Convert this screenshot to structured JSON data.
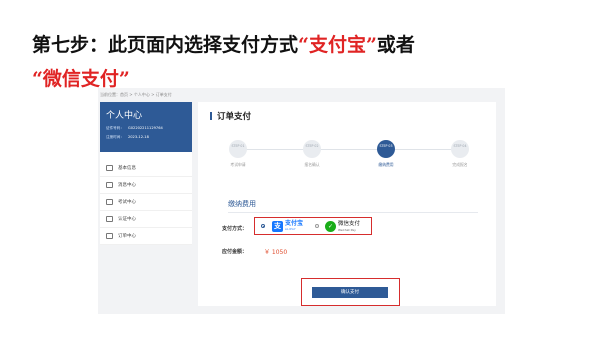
{
  "headline": {
    "part1": "第七步：此页面内选择支付方式",
    "alipay_quoted": "“支付宝”",
    "part2": "或者",
    "wechat_quoted": "“微信支付”"
  },
  "breadcrumb": "当前位置：首页 > 个人中心 > 订单支付",
  "sidebar": {
    "title": "个人中心",
    "id_label": "证件号码：",
    "id_value": "G02202211129764",
    "date_label": "注册时间：",
    "date_value": "2023-12-18",
    "items": [
      {
        "label": "基本信息",
        "icon": "user-icon"
      },
      {
        "label": "消息中心",
        "icon": "message-icon"
      },
      {
        "label": "考试中心",
        "icon": "exam-icon"
      },
      {
        "label": "认证中心",
        "icon": "cert-icon"
      },
      {
        "label": "订单中心",
        "icon": "order-icon"
      }
    ]
  },
  "main": {
    "title": "订单支付",
    "steps": [
      {
        "code": "STEP 01",
        "label": "考试申请",
        "active": false
      },
      {
        "code": "STEP 02",
        "label": "报名确认",
        "active": false
      },
      {
        "code": "STEP 03",
        "label": "缴纳费用",
        "active": true
      },
      {
        "code": "STEP 04",
        "label": "完成报名",
        "active": false
      }
    ],
    "section_title": "缴纳费用",
    "pay_method_label": "支付方式：",
    "alipay": {
      "cn": "支付宝",
      "en": "ALIPAY"
    },
    "wechat": {
      "cn": "微信支付",
      "en": "WeChat Pay"
    },
    "amount_label": "应付金额：",
    "amount_value": "￥ 1050",
    "submit_label": "确认支付"
  },
  "colors": {
    "brand": "#2e5a96",
    "highlight": "#e02424",
    "alipay": "#1677ff",
    "wechat": "#1aad19",
    "price": "#e04e2f"
  }
}
